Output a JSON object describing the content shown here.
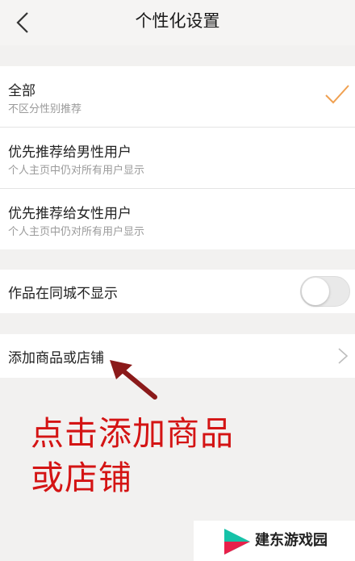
{
  "header": {
    "title": "个性化设置",
    "back_icon": "chevron-left-icon"
  },
  "recommend_options": [
    {
      "label": "全部",
      "sub": "不区分性别推荐",
      "selected": true
    },
    {
      "label": "优先推荐给男性用户",
      "sub": "个人主页中仍对所有用户显示",
      "selected": false
    },
    {
      "label": "优先推荐给女性用户",
      "sub": "个人主页中仍对所有用户显示",
      "selected": false
    }
  ],
  "city_toggle": {
    "label": "作品在同城不显示",
    "enabled": false
  },
  "add_goods": {
    "label": "添加商品或店铺"
  },
  "annotation": {
    "line1": "点击添加商品",
    "line2": "或店铺"
  },
  "watermark": {
    "text": "建东游戏园"
  },
  "colors": {
    "accent_check": "#f0a050",
    "annotation_red": "#d41414"
  }
}
